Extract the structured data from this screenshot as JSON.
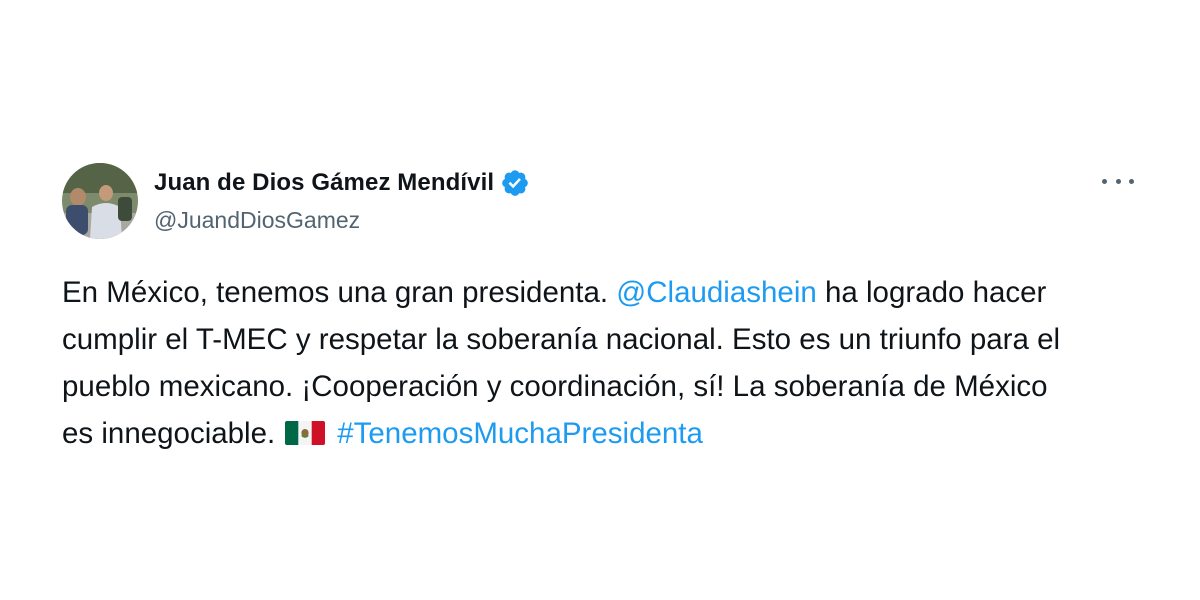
{
  "author": {
    "display_name": "Juan de Dios Gámez Mendívil",
    "handle": "@JuandDiosGamez",
    "verified": true,
    "avatar_icon": "profile-photo"
  },
  "menu": {
    "icon": "more-options-icon"
  },
  "tweet": {
    "line1_pre": "En México, tenemos una gran presidenta. ",
    "mention": "@Claudiashein",
    "line1_post": " ha logrado hacer",
    "line2": "cumplir el T-MEC y respetar la soberanía nacional. Esto es un triunfo para el",
    "line3": "pueblo mexicano. ¡Cooperación y coordinación, sí! La soberanía de México",
    "line4_pre": "es innegociable.",
    "flag_icon": "mexico-flag-emoji",
    "hashtag": "#TenemosMuchaPresidenta"
  },
  "colors": {
    "link": "#1d9bf0",
    "verified": "#1d9bf0",
    "secondary_text": "#536471",
    "primary_text": "#0f1419"
  }
}
